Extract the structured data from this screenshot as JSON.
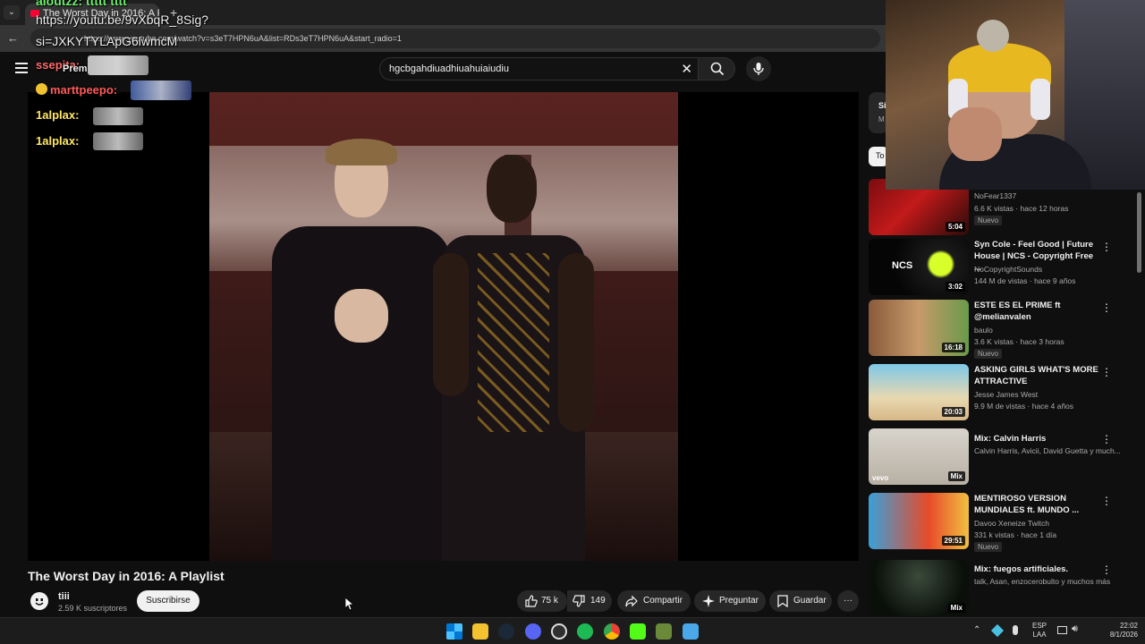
{
  "browser": {
    "tab_title": "The Worst Day in 2016: A P",
    "url": "https://www.youtube.com/watch?v=s3eT7HPN6uA&list=RDs3eT7HPN6uA&start_radio=1",
    "url_tail": "s3eT7HPN6uA&list=RDs3eT7HPN6uA&start_radio=1"
  },
  "search": {
    "query": "hgcbgahdiuadhiuahuiaiudiu"
  },
  "chat_overlay": {
    "top_line": "aloutzz: ttttt tttt",
    "link_line_1": "https://youtu.be/9vXbqR_8Sig?",
    "link_line_2": "si=JXKYTYLApG6lwmcM",
    "partial": "Prem",
    "messages": [
      {
        "user": "ssepita:",
        "color": "#ff5a5a"
      },
      {
        "user": "marttpeepo:",
        "color": "#ff5a5a"
      },
      {
        "user": "1alplax:",
        "color": "#ffe766"
      },
      {
        "user": "1alplax:",
        "color": "#ffe766"
      }
    ]
  },
  "video": {
    "title": "The Worst Day in 2016: A Playlist",
    "channel": "tiii",
    "subscribers": "2.59 K suscriptores",
    "subscribe_label": "Suscribirse",
    "likes": "75 k",
    "dislikes": "149",
    "share_label": "Compartir",
    "ask_label": "Preguntar",
    "save_label": "Guardar",
    "more_label": "···"
  },
  "sidebar": {
    "top_card_letter": "Si",
    "top_card_sub": "M",
    "chip": "To",
    "recommendations": [
      {
        "title": "",
        "channel": "NoFear1337",
        "meta": "6.6 K vistas · hace 12 horas",
        "badge": "Nuevo",
        "duration": "5:04",
        "thumb": "linear-gradient(135deg,#7a0c10,#c21a1a 45%,#2a0a0a)"
      },
      {
        "title": "Syn Cole - Feel Good | Future House | NCS - Copyright Free ...",
        "channel": "NoCopyrightSounds",
        "meta": "144 M de vistas · hace 9 años",
        "badge": "",
        "duration": "3:02",
        "thumb": "radial-gradient(circle at 70% 50%,#d8ff2a 0 18%,#1a1a1a 22%,#050505 60%)"
      },
      {
        "title": "ESTE ES EL PRIME ft @melianvalen",
        "channel": "baulo",
        "meta": "3.6 K vistas · hace 3 horas",
        "badge": "Nuevo",
        "duration": "16:18",
        "thumb": "linear-gradient(90deg,#8a5a3a,#c79a6a 50%,#6a9a4a)"
      },
      {
        "title": "ASKING GIRLS WHAT'S MORE ATTRACTIVE",
        "channel": "Jesse James West",
        "meta": "9.9 M de vistas · hace 4 años",
        "badge": "",
        "duration": "20:03",
        "thumb": "linear-gradient(180deg,#7ec8e8,#e8d8b0 60%,#d8b888)"
      },
      {
        "title": "Mix: Calvin Harris",
        "channel": "Calvin Harris, Avicii, David Guetta y much...",
        "meta": "",
        "badge": "",
        "duration": "Mix",
        "thumb": "linear-gradient(180deg,#d8d4cc,#b8b0a4)"
      },
      {
        "title": "MENTIROSO VERSION MUNDIALES ft. MUNDO ...",
        "channel": "Davoo Xeneize Twitch",
        "meta": "331 k vistas · hace 1 día",
        "badge": "Nuevo",
        "duration": "29:51",
        "thumb": "linear-gradient(90deg,#3aa0d8,#e84a2a 60%,#f0c040)"
      },
      {
        "title": "Mix: fuegos artificiales.",
        "channel": "talk, Asan, enzocerobulto y muchos más",
        "meta": "",
        "badge": "",
        "duration": "Mix",
        "thumb": "radial-gradient(circle at 50% 30%,#3a4a3a,#0a0f0a 70%)"
      }
    ]
  },
  "taskbar": {
    "lang_1": "ESP",
    "lang_2": "LAA",
    "time": "22:02",
    "date": "8/1/2026"
  }
}
